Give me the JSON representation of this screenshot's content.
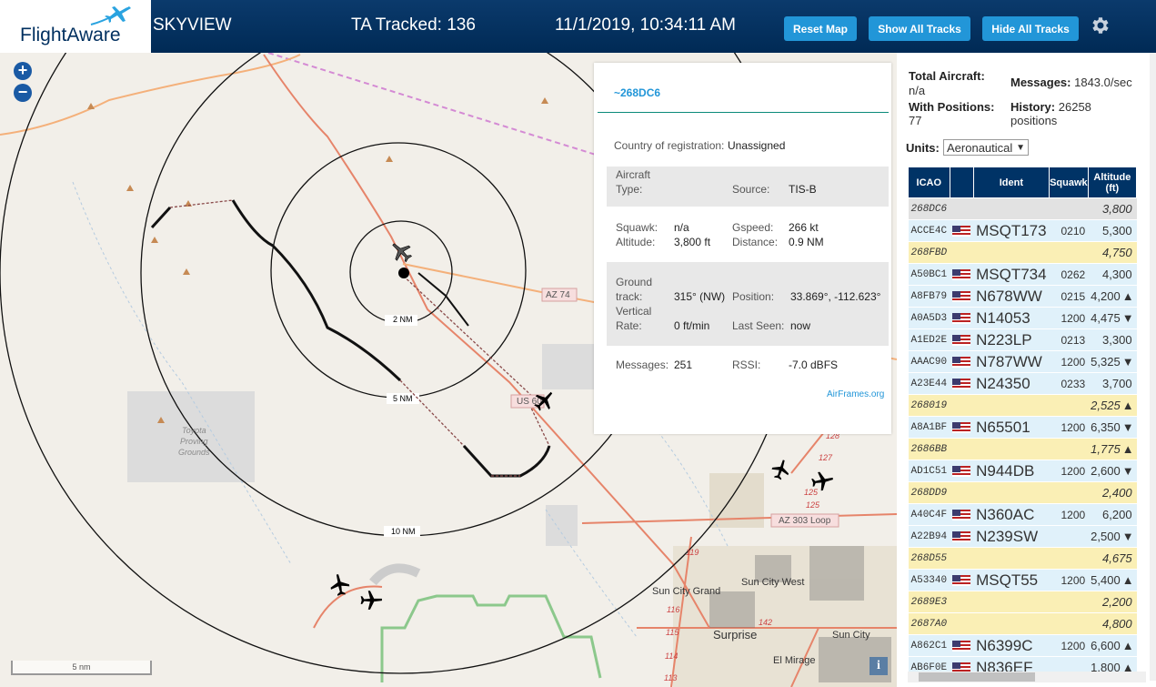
{
  "header": {
    "logo_text": "FlightAware",
    "site_name": "SKYVIEW",
    "tracked": "TA Tracked: 136",
    "datetime": "11/1/2019, 10:34:11 AM",
    "buttons": {
      "reset": "Reset Map",
      "show": "Show All Tracks",
      "hide": "Hide All Tracks"
    }
  },
  "map": {
    "zoom_in": "+",
    "zoom_out": "−",
    "scale_label": "5 nm",
    "range_rings": [
      "2 NM",
      "5 NM",
      "10 NM"
    ],
    "road_labels": [
      "AZ 74",
      "US 60",
      "AZ 303 Loop"
    ],
    "place_labels": [
      "Toyota",
      "Proving",
      "Grounds",
      "Sun City West",
      "Sun City Grand",
      "Surprise",
      "Sun City",
      "El Mirage"
    ],
    "route_numbers": [
      "119",
      "116",
      "115",
      "114",
      "113",
      "142",
      "128",
      "127",
      "125",
      "125",
      "119"
    ],
    "info_button": "i"
  },
  "popup": {
    "hex": "~268DC6",
    "country_label": "Country of registration:",
    "country_value": "Unassigned",
    "aircraft_type_label1": "Aircraft",
    "aircraft_type_label2": "Type:",
    "source_label": "Source:",
    "source_value": "TIS-B",
    "squawk_label": "Squawk:",
    "squawk_value": "n/a",
    "gspeed_label": "Gspeed:",
    "gspeed_value": "266 kt",
    "altitude_label": "Altitude:",
    "altitude_value": "3,800 ft",
    "distance_label": "Distance:",
    "distance_value": "0.9 NM",
    "ground_label1": "Ground",
    "ground_label2": "track:",
    "ground_value": "315° (NW)",
    "position_label": "Position:",
    "position_value": "33.869°, -112.623°",
    "vrate_label1": "Vertical",
    "vrate_label2": "Rate:",
    "vrate_value": "0 ft/min",
    "lastseen_label": "Last Seen:",
    "lastseen_value": "now",
    "messages_label": "Messages:",
    "messages_value": "251",
    "rssi_label": "RSSI:",
    "rssi_value": "-7.0 dBFS",
    "airframes_link": "AirFrames.org"
  },
  "sidebar": {
    "total_aircraft_label": "Total Aircraft:",
    "total_aircraft_value": "n/a",
    "messages_label": "Messages:",
    "messages_value": "1843.0/sec",
    "with_positions_label": "With Positions:",
    "with_positions_value": "77",
    "history_label": "History:",
    "history_value": "26258",
    "history_unit": "positions",
    "units_label": "Units:",
    "units_value": "Aeronautical",
    "columns": [
      "ICAO",
      "",
      "Ident",
      "Squawk",
      "Altitude (ft)"
    ],
    "rows": [
      {
        "icao": "268DC6",
        "flag": false,
        "ident": "",
        "squawk": "",
        "alt": "3,800",
        "trend": "",
        "style": "gray"
      },
      {
        "icao": "ACCE4C",
        "flag": true,
        "ident": "MSQT173",
        "squawk": "0210",
        "alt": "5,300",
        "trend": "",
        "style": "blue"
      },
      {
        "icao": "268FBD",
        "flag": false,
        "ident": "",
        "squawk": "",
        "alt": "4,750",
        "trend": "",
        "style": "yellow"
      },
      {
        "icao": "A50BC1",
        "flag": true,
        "ident": "MSQT734",
        "squawk": "0262",
        "alt": "4,300",
        "trend": "",
        "style": "blue"
      },
      {
        "icao": "A8FB79",
        "flag": true,
        "ident": "N678WW",
        "squawk": "0215",
        "alt": "4,200",
        "trend": "▲",
        "style": "blue"
      },
      {
        "icao": "A0A5D3",
        "flag": true,
        "ident": "N14053",
        "squawk": "1200",
        "alt": "4,475",
        "trend": "▼",
        "style": "blue"
      },
      {
        "icao": "A1ED2E",
        "flag": true,
        "ident": "N223LP",
        "squawk": "0213",
        "alt": "3,300",
        "trend": "",
        "style": "blue"
      },
      {
        "icao": "AAAC90",
        "flag": true,
        "ident": "N787WW",
        "squawk": "1200",
        "alt": "5,325",
        "trend": "▼",
        "style": "blue"
      },
      {
        "icao": "A23E44",
        "flag": true,
        "ident": "N24350",
        "squawk": "0233",
        "alt": "3,700",
        "trend": "",
        "style": "blue"
      },
      {
        "icao": "268019",
        "flag": false,
        "ident": "",
        "squawk": "",
        "alt": "2,525",
        "trend": "▲",
        "style": "yellow"
      },
      {
        "icao": "A8A1BF",
        "flag": true,
        "ident": "N65501",
        "squawk": "1200",
        "alt": "6,350",
        "trend": "▼",
        "style": "blue"
      },
      {
        "icao": "2686BB",
        "flag": false,
        "ident": "",
        "squawk": "",
        "alt": "1,775",
        "trend": "▲",
        "style": "yellow"
      },
      {
        "icao": "AD1C51",
        "flag": true,
        "ident": "N944DB",
        "squawk": "1200",
        "alt": "2,600",
        "trend": "▼",
        "style": "blue"
      },
      {
        "icao": "268DD9",
        "flag": false,
        "ident": "",
        "squawk": "",
        "alt": "2,400",
        "trend": "",
        "style": "yellow"
      },
      {
        "icao": "A40C4F",
        "flag": true,
        "ident": "N360AC",
        "squawk": "1200",
        "alt": "6,200",
        "trend": "",
        "style": "blue"
      },
      {
        "icao": "A22B94",
        "flag": true,
        "ident": "N239SW",
        "squawk": "",
        "alt": "2,500",
        "trend": "▼",
        "style": "blue"
      },
      {
        "icao": "268D55",
        "flag": false,
        "ident": "",
        "squawk": "",
        "alt": "4,675",
        "trend": "",
        "style": "yellow"
      },
      {
        "icao": "A53340",
        "flag": true,
        "ident": "MSQT55",
        "squawk": "1200",
        "alt": "5,400",
        "trend": "▲",
        "style": "blue"
      },
      {
        "icao": "2689E3",
        "flag": false,
        "ident": "",
        "squawk": "",
        "alt": "2,200",
        "trend": "",
        "style": "yellow"
      },
      {
        "icao": "2687A0",
        "flag": false,
        "ident": "",
        "squawk": "",
        "alt": "4,800",
        "trend": "",
        "style": "yellow"
      },
      {
        "icao": "A862C1",
        "flag": true,
        "ident": "N6399C",
        "squawk": "1200",
        "alt": "6,600",
        "trend": "▲",
        "style": "blue"
      },
      {
        "icao": "AB6F0E",
        "flag": true,
        "ident": "N836EF",
        "squawk": "",
        "alt": "1,800",
        "trend": "▲",
        "style": "blue"
      }
    ]
  }
}
